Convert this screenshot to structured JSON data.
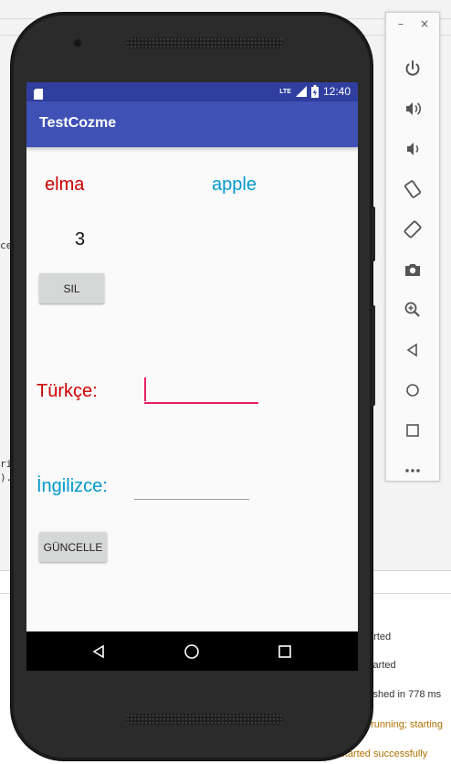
{
  "app": {
    "title": "TestCozme",
    "status_time": "12:40",
    "status_network": "LTE"
  },
  "content": {
    "word_tr": "elma",
    "word_en": "apple",
    "count": "3",
    "delete_button": "SIL",
    "label_tr": "Türkçe:",
    "label_en": "İngilizce:",
    "input_tr_value": "",
    "input_en_value": "",
    "update_button": "GÜNCELLE"
  },
  "ide": {
    "code_fragments": [
      "ce",
      "ri",
      ")."
    ],
    "log_lines": [
      "tarted",
      "started",
      "nished in 778 ms",
      "t running; starting",
      "12:38 PM    * daemon started successfully"
    ]
  },
  "emulator_toolbar": {
    "minimize": "–",
    "close": "×",
    "buttons": [
      "power-icon",
      "volume-up-icon",
      "volume-down-icon",
      "rotate-left-icon",
      "rotate-right-icon",
      "camera-icon",
      "zoom-icon",
      "back-icon",
      "home-icon",
      "overview-icon",
      "more-icon"
    ]
  },
  "colors": {
    "primary": "#3f51b5",
    "primary_dark": "#303f9f",
    "accent": "#e91e63",
    "text_red": "#cc0000",
    "text_blue": "#0099cc"
  }
}
